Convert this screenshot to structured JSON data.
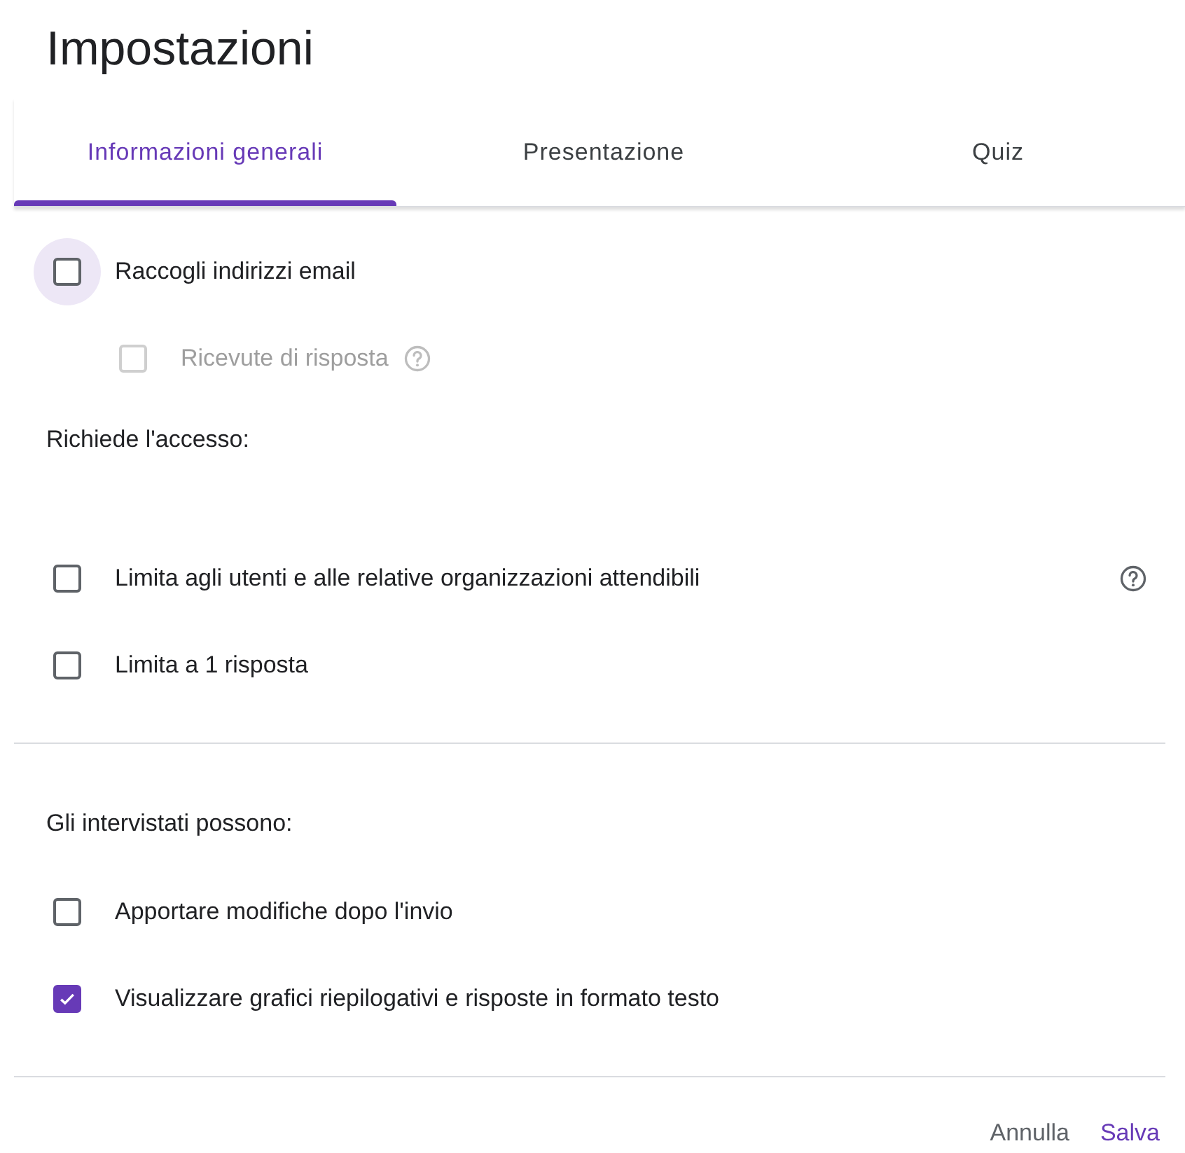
{
  "title": "Impostazioni",
  "tabs": [
    {
      "label": "Informazioni generali",
      "selected": true
    },
    {
      "label": "Presentazione",
      "selected": false
    },
    {
      "label": "Quiz",
      "selected": false
    }
  ],
  "sections": [
    {
      "items": [
        {
          "label": "Raccogli indirizzi email",
          "checked": false,
          "focused": true,
          "disabled": false,
          "help": false,
          "children": [
            {
              "label": "Ricevute di risposta",
              "checked": false,
              "focused": false,
              "disabled": true,
              "help": true
            }
          ]
        }
      ]
    },
    {
      "heading": "Richiede l'accesso:",
      "items": [
        {
          "label": "Limita agli utenti e alle relative organizzazioni attendibili",
          "checked": false,
          "focused": false,
          "disabled": false,
          "help": true
        },
        {
          "label": "Limita a 1 risposta",
          "checked": false,
          "focused": false,
          "disabled": false,
          "help": false
        }
      ]
    },
    {
      "heading": "Gli intervistati possono:",
      "items": [
        {
          "label": "Apportare modifiche dopo l'invio",
          "checked": false,
          "focused": false,
          "disabled": false,
          "help": false
        },
        {
          "label": "Visualizzare grafici riepilogativi e risposte in formato testo",
          "checked": true,
          "focused": false,
          "disabled": false,
          "help": false
        }
      ]
    }
  ],
  "buttons": [
    {
      "label": "Annulla",
      "kind": "secondary"
    },
    {
      "label": "Salva",
      "kind": "primary"
    }
  ]
}
